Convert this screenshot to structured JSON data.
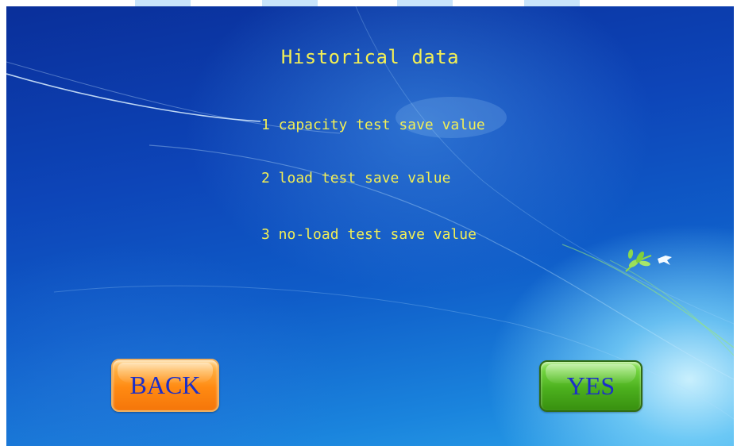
{
  "screen": {
    "title": "Historical data"
  },
  "menu": {
    "items": [
      {
        "label": "1 capacity test save value"
      },
      {
        "label": "2 load test save value"
      },
      {
        "label": "3 no-load test save value"
      }
    ]
  },
  "buttons": {
    "back_label": "BACK",
    "yes_label": "YES"
  },
  "colors": {
    "text_accent": "#f2ef55",
    "button_text": "#1b2fc9",
    "back_button": "#ff8a12",
    "yes_button": "#4cb01e",
    "background": "#0d45b8"
  },
  "icons": {
    "decoration": "bird-and-leaves-icon"
  }
}
